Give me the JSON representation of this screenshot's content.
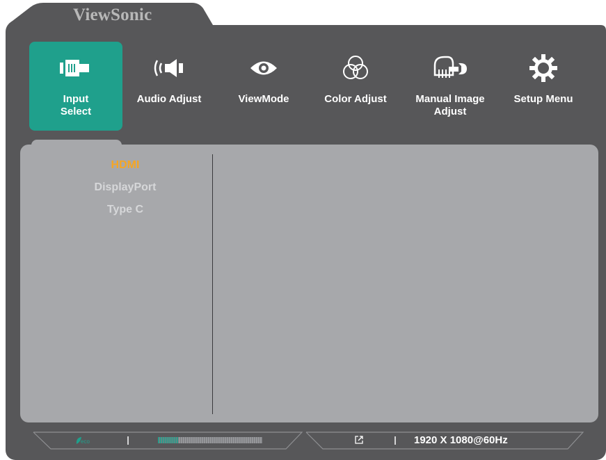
{
  "brand": {
    "name": "ViewSonic"
  },
  "menu": {
    "tabs": [
      {
        "label_line1": "Input",
        "label_line2": "Select",
        "icon": "input-plug-icon",
        "active": true
      },
      {
        "label_line1": "Audio Adjust",
        "label_line2": "",
        "icon": "speaker-icon",
        "active": false
      },
      {
        "label_line1": "ViewMode",
        "label_line2": "",
        "icon": "eye-icon",
        "active": false
      },
      {
        "label_line1": "Color Adjust",
        "label_line2": "",
        "icon": "color-circles-icon",
        "active": false
      },
      {
        "label_line1": "Manual Image",
        "label_line2": "Adjust",
        "icon": "hand-wrench-icon",
        "active": false
      },
      {
        "label_line1": "Setup Menu",
        "label_line2": "",
        "icon": "gear-icon",
        "active": false
      }
    ]
  },
  "input_options": {
    "items": [
      "HDMI",
      "DisplayPort",
      "Type C"
    ],
    "selected": "HDMI"
  },
  "status_bar": {
    "eco_label": "eco",
    "signal_level": 0.2,
    "resolution": "1920 X 1080@60Hz",
    "link_icon": "external-link-icon"
  },
  "colors": {
    "accent": "#1fa08c",
    "selected_text": "#f6a623",
    "panel": "#a7a8ab",
    "frame": "#575759"
  }
}
